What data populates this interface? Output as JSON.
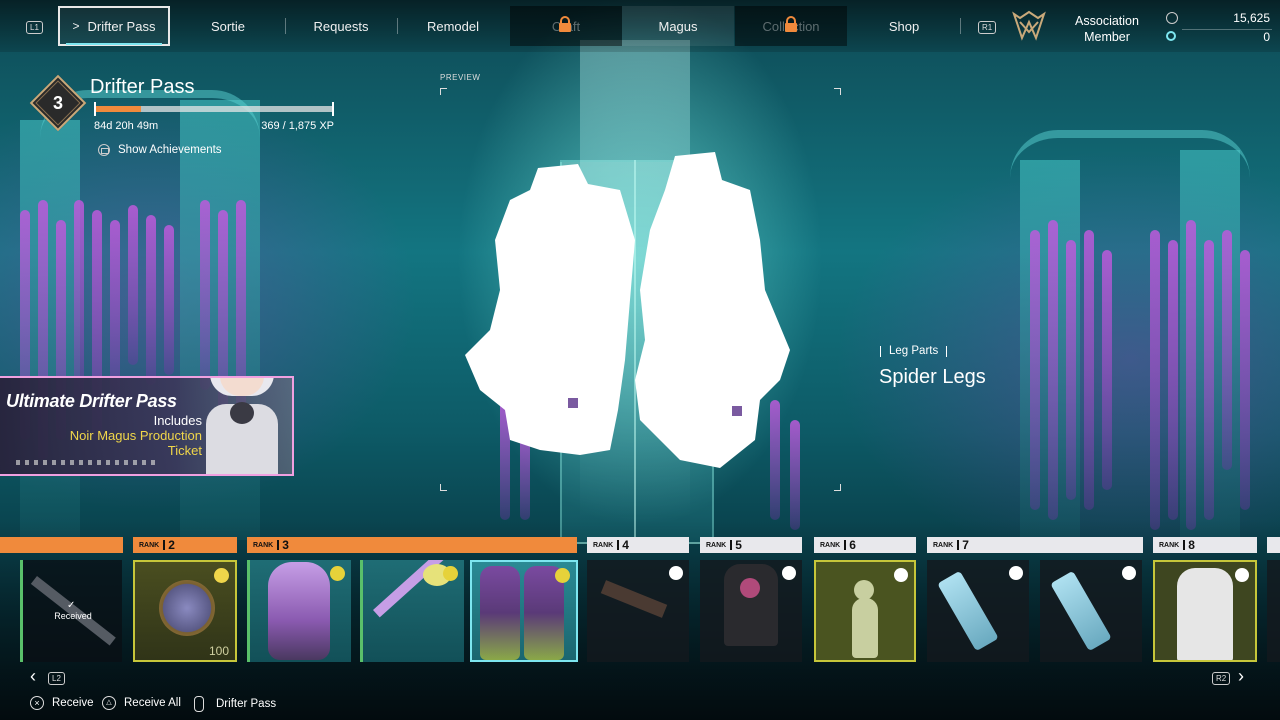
{
  "nav": {
    "l1": "L1",
    "r1": "R1",
    "tabs": [
      {
        "label": "Drifter Pass"
      },
      {
        "label": "Sortie"
      },
      {
        "label": "Requests"
      },
      {
        "label": "Remodel"
      },
      {
        "label": "Craft"
      },
      {
        "label": "Magus"
      },
      {
        "label": "Collection"
      },
      {
        "label": "Shop"
      }
    ]
  },
  "account": {
    "title_line1": "Association",
    "title_line2": "Member",
    "currency1": "15,625",
    "currency2": "0"
  },
  "pass": {
    "rank": "3",
    "title": "Drifter Pass",
    "time_left": "84d 20h 49m",
    "xp": "369 / 1,875 XP",
    "xp_progress": 0.197,
    "achievements_label": "Show Achievements"
  },
  "preview": {
    "label": "PREVIEW",
    "category": "Leg Parts",
    "item_name": "Spider Legs"
  },
  "promo": {
    "title": "Ultimate Drifter Pass",
    "includes": "Includes",
    "item_line1": "Noir Magus Production",
    "item_line2": "Ticket"
  },
  "ranks": [
    {
      "label": "RANK",
      "num": "2"
    },
    {
      "label": "RANK",
      "num": "3"
    },
    {
      "label": "RANK",
      "num": "4"
    },
    {
      "label": "RANK",
      "num": "5"
    },
    {
      "label": "RANK",
      "num": "6"
    },
    {
      "label": "RANK",
      "num": "7"
    },
    {
      "label": "RANK",
      "num": "8"
    }
  ],
  "rewards": {
    "received_label": "Received",
    "coin_count": "100"
  },
  "strip_nav": {
    "l2": "L2",
    "r2": "R2"
  },
  "footer": {
    "receive": "Receive",
    "receive_all": "Receive All",
    "drifter_pass": "Drifter Pass"
  },
  "colors": {
    "accent_orange": "#f08a3c",
    "accent_yellow": "#f0d64a",
    "highlight_cyan": "#7de6f0"
  }
}
